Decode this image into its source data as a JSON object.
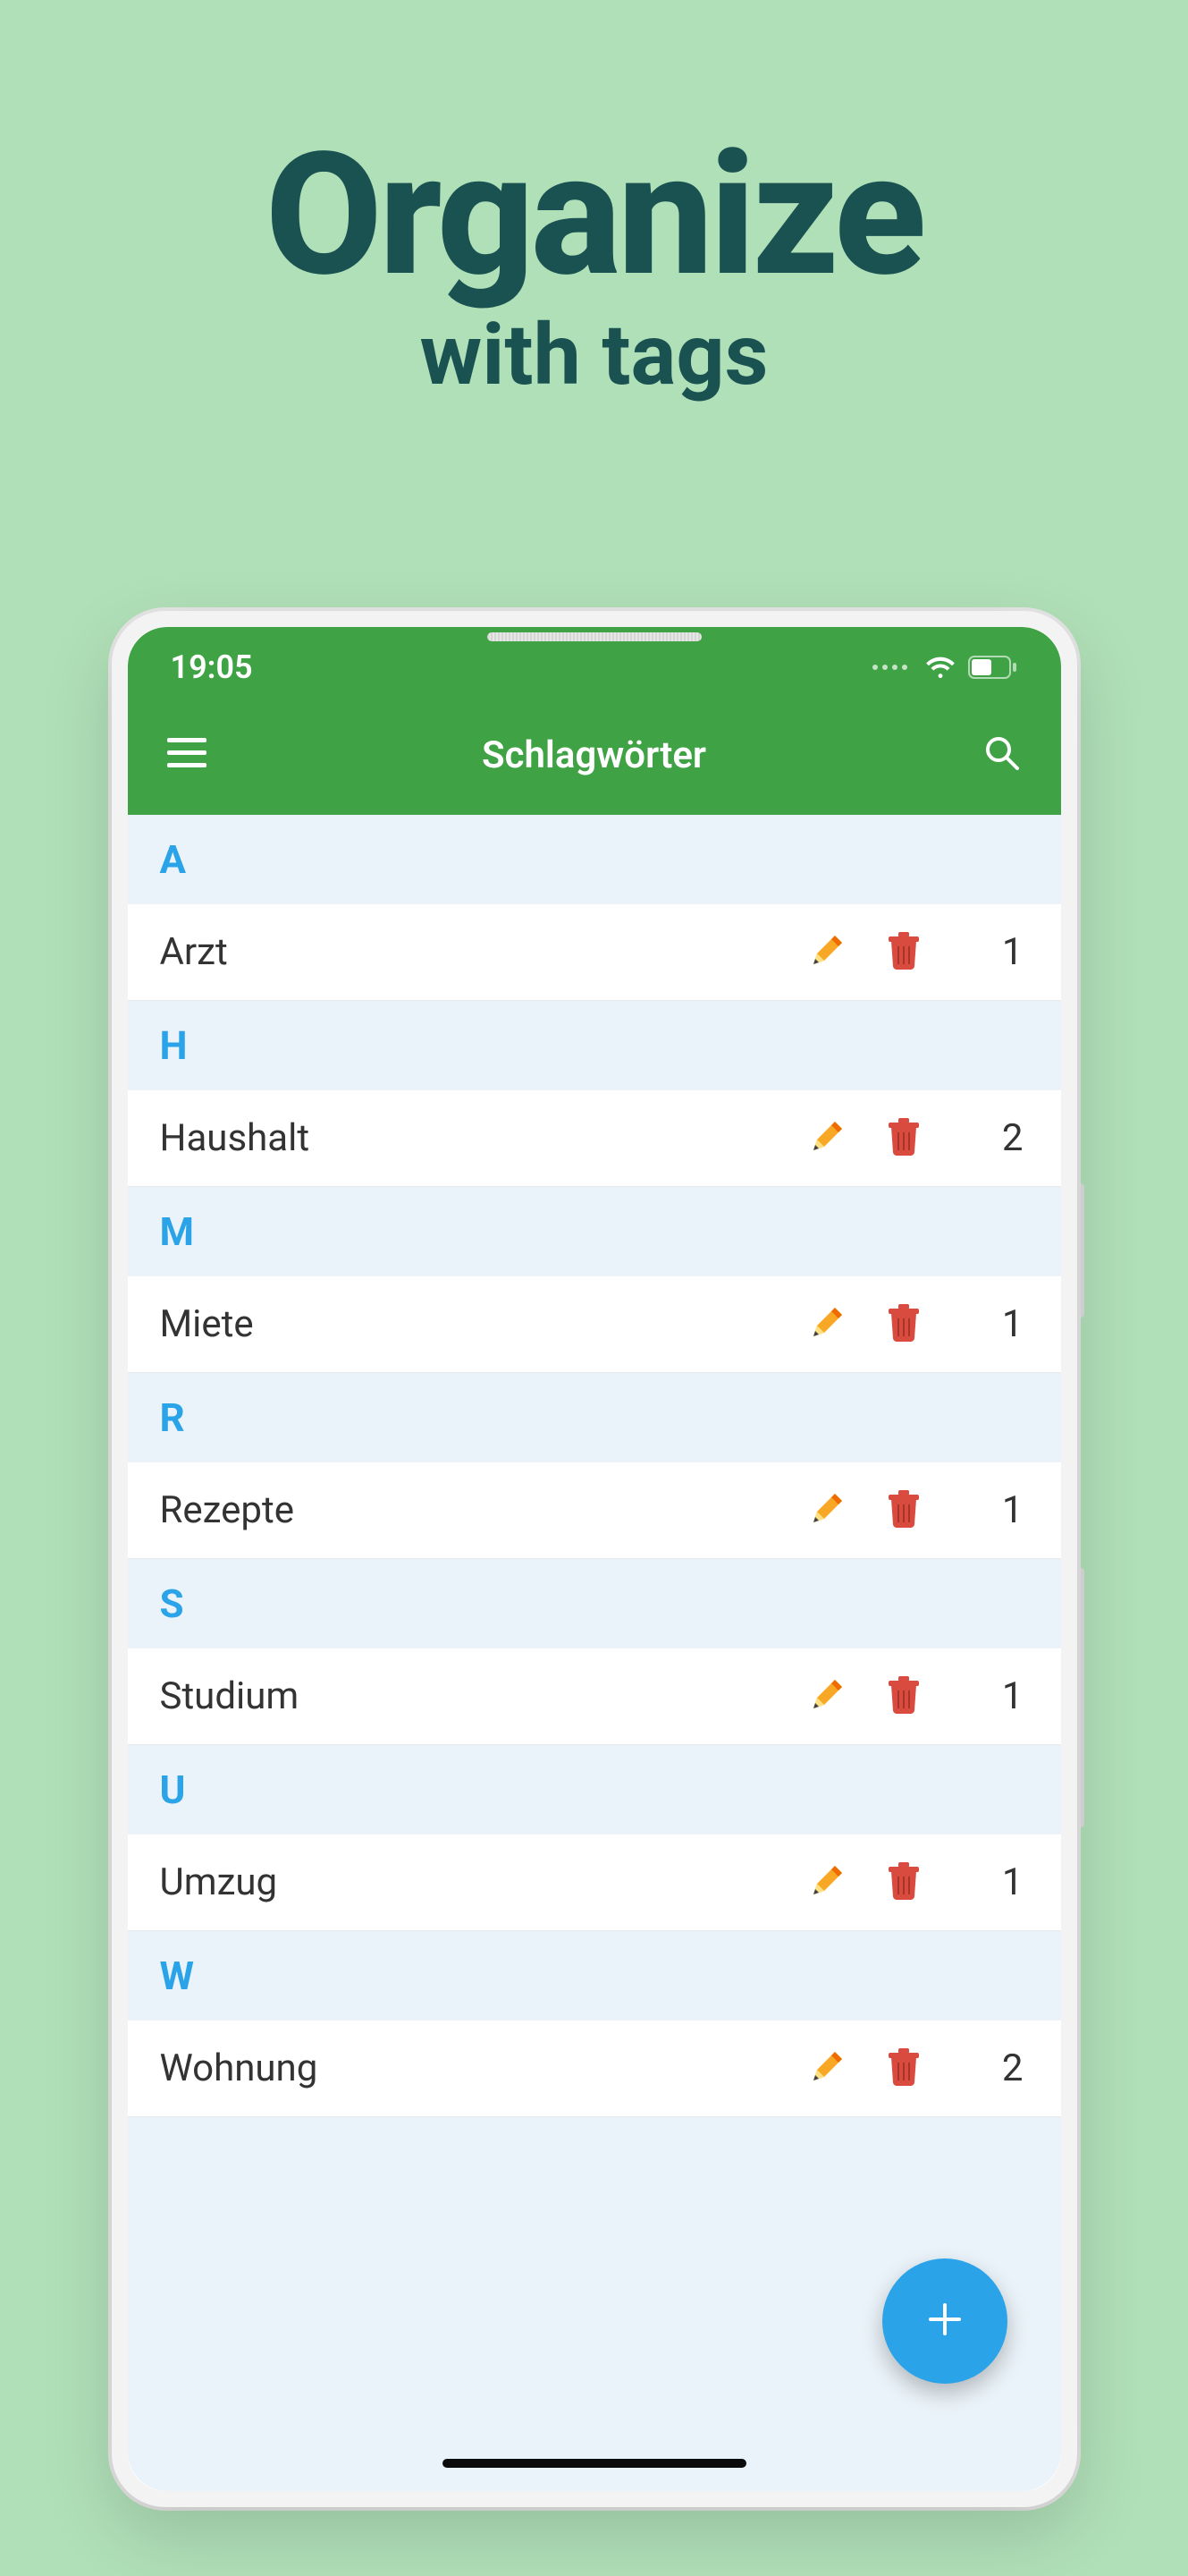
{
  "hero": {
    "title": "Organize",
    "subtitle": "with tags"
  },
  "status": {
    "time": "19:05"
  },
  "appbar": {
    "title": "Schlagwörter"
  },
  "sections": [
    {
      "letter": "A",
      "items": [
        {
          "label": "Arzt",
          "count": "1"
        }
      ]
    },
    {
      "letter": "H",
      "items": [
        {
          "label": "Haushalt",
          "count": "2"
        }
      ]
    },
    {
      "letter": "M",
      "items": [
        {
          "label": "Miete",
          "count": "1"
        }
      ]
    },
    {
      "letter": "R",
      "items": [
        {
          "label": "Rezepte",
          "count": "1"
        }
      ]
    },
    {
      "letter": "S",
      "items": [
        {
          "label": "Studium",
          "count": "1"
        }
      ]
    },
    {
      "letter": "U",
      "items": [
        {
          "label": "Umzug",
          "count": "1"
        }
      ]
    },
    {
      "letter": "W",
      "items": [
        {
          "label": "Wohnung",
          "count": "2"
        }
      ]
    }
  ]
}
